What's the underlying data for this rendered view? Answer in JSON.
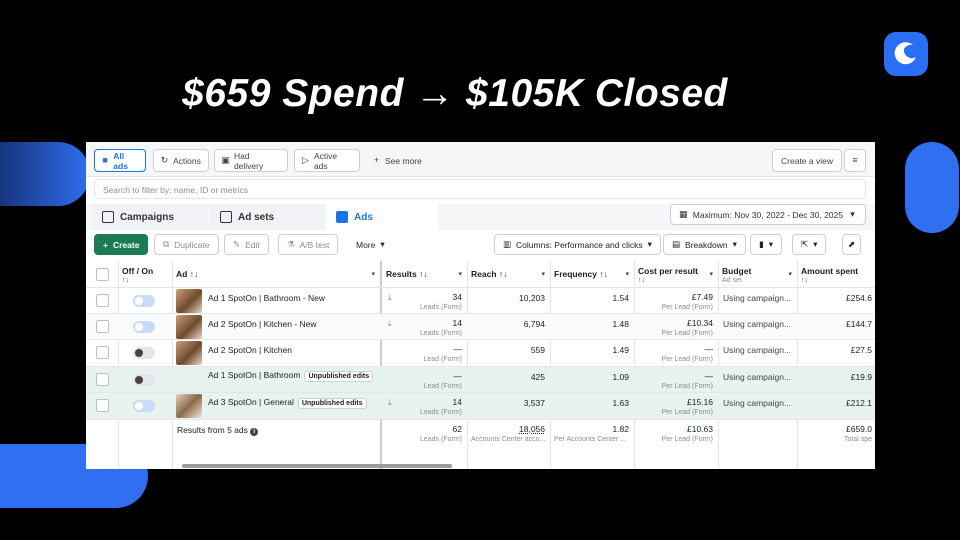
{
  "headline": "$659 Spend → $105K Closed",
  "colors": {
    "accent": "#1b74e4",
    "create": "#1a7b55",
    "brand_blue": "#2f6ff0"
  },
  "topbar": {
    "chips": [
      {
        "label": "All ads",
        "icon": "folder-icon"
      },
      {
        "label": "Actions",
        "icon": "refresh-icon"
      },
      {
        "label": "Had delivery",
        "icon": "camera-icon"
      },
      {
        "label": "Active ads",
        "icon": "play-icon"
      },
      {
        "label": "See more",
        "icon": "plus-icon"
      }
    ],
    "create_view": "Create a view"
  },
  "search": {
    "placeholder": "Search to filter by: name, ID or metrics"
  },
  "tabs": [
    {
      "label": "Campaigns"
    },
    {
      "label": "Ad sets"
    },
    {
      "label": "Ads"
    }
  ],
  "date_range": "Maximum: Nov 30, 2022 - Dec 30, 2025",
  "toolbar": {
    "create": "Create",
    "duplicate": "Duplicate",
    "edit": "Edit",
    "ab_test": "A/B test",
    "more": "More",
    "columns": "Columns: Performance and clicks",
    "breakdown": "Breakdown"
  },
  "columns": {
    "onoff": "Off / On",
    "ad": "Ad",
    "results": "Results",
    "reach": "Reach",
    "frequency": "Frequency",
    "cpr": "Cost per result",
    "budget": "Budget",
    "budget_sub": "Ad set",
    "spent": "Amount spent",
    "sort": "↑↓"
  },
  "rows": [
    {
      "name": "Ad 1 SpotOn | Bathroom - New",
      "badge": "",
      "results": "34",
      "results_sub": "Leads (Form)",
      "reach": "10,203",
      "frequency": "1.54",
      "cpr": "£7.49",
      "cpr_sub": "Per Lead (Form)",
      "budget": "Using campaign...",
      "spent": "£254.6"
    },
    {
      "name": "Ad 2 SpotOn | Kitchen - New",
      "badge": "",
      "results": "14",
      "results_sub": "Leads (Form)",
      "reach": "6,794",
      "frequency": "1.48",
      "cpr": "£10.34",
      "cpr_sub": "Per Lead (Form)",
      "budget": "Using campaign...",
      "spent": "£144.7"
    },
    {
      "name": "Ad 2 SpotOn | Kitchen",
      "badge": "",
      "results": "—",
      "results_sub": "Lead (Form)",
      "reach": "559",
      "frequency": "1.49",
      "cpr": "—",
      "cpr_sub": "Per Lead (Form)",
      "budget": "Using campaign...",
      "spent": "£27.5"
    },
    {
      "name": "Ad 1 SpotOn | Bathroom",
      "badge": "Unpublished edits",
      "results": "—",
      "results_sub": "Lead (Form)",
      "reach": "425",
      "frequency": "1.09",
      "cpr": "—",
      "cpr_sub": "Per Lead (Form)",
      "budget": "Using campaign...",
      "spent": "£19.9"
    },
    {
      "name": "Ad 3 SpotOn | General",
      "badge": "Unpublished edits",
      "results": "14",
      "results_sub": "Leads (Form)",
      "reach": "3,537",
      "frequency": "1.63",
      "cpr": "£15.16",
      "cpr_sub": "Per Lead (Form)",
      "budget": "Using campaign...",
      "spent": "£212.1"
    }
  ],
  "totals": {
    "label": "Results from 5 ads",
    "results": "62",
    "results_sub": "Leads (Form)",
    "reach": "18,056",
    "reach_sub": "Accounts Center acco...",
    "frequency": "1.82",
    "frequency_sub": "Per Accounts Center ...",
    "cpr": "£10.63",
    "cpr_sub": "Per Lead (Form)",
    "spent": "£659.0",
    "spent_sub": "Total spe"
  }
}
